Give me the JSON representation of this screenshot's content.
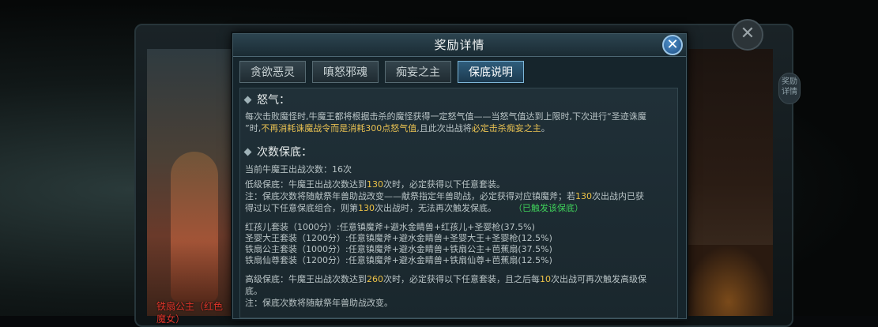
{
  "background": {
    "title": "",
    "left_name": "铁扇公主（红色\n魔女）",
    "side_tab": "奖励\n详情",
    "close_glyph": "✕"
  },
  "dialog": {
    "title": "奖励详情",
    "close_glyph": "✕",
    "tabs": [
      {
        "label": "贪欲恶灵",
        "active": false
      },
      {
        "label": "嗔怒邪魂",
        "active": false
      },
      {
        "label": "痴妄之主",
        "active": false
      },
      {
        "label": "保底说明",
        "active": true
      }
    ]
  },
  "rage": {
    "heading": "怒气：",
    "p1_a": "每次击败魔怪时,牛魔王都将根据击杀的魔怪获得一定怒气值——当怒气值达到上限时,下次进行“圣迹诛魔",
    "p1_b": "”时,",
    "p1_hl1": "不再消耗诛魔战令而是消耗300点怒气值",
    "p1_c": ",且此次出战将",
    "p1_hl2": "必定击杀痴妄之主",
    "p1_d": "。"
  },
  "pity": {
    "heading": "次数保底：",
    "current": "当前牛魔王出战次数：16次",
    "low_a": "低级保底：牛魔王出战次数达到",
    "low_num": "130",
    "low_b": "次时，必定获得以下任意套装。",
    "note1_a": "注：保底次数将随献祭年兽助战改变——献祭指定年兽助战，必定获得对应镇魔斧；若",
    "note1_num": "130",
    "note1_b": "次出战内已获",
    "note2_a": "得过以下任意保底组合，则第",
    "note2_num": "130",
    "note2_b": "次出战时，无法再次触发保底。",
    "triggered": "（已触发该保底）",
    "sets": [
      "红孩儿套装（1000分）:任意镇魔斧+避水金睛兽+红孩儿+圣婴枪(37.5%)",
      "圣婴大王套装（1200分）:任意镇魔斧+避水金睛兽+圣婴大王+圣婴枪(12.5%)",
      "铁扇公主套装（1000分）:任意镇魔斧+避水金睛兽+铁扇公主+芭蕉扇(37.5%)",
      "铁扇仙尊套装（1200分）:任意镇魔斧+避水金睛兽+铁扇仙尊+芭蕉扇(12.5%)"
    ],
    "high_a": "高级保底：牛魔王出战次数达到",
    "high_num": "260",
    "high_b": "次时，必定获得以下任意套装，且之后每",
    "high_num2": "10",
    "high_c": "次出战可再次触发高级保",
    "high_d": "底。",
    "note3": "注：保底次数将随献祭年兽助战改变。"
  },
  "colors": {
    "highlight": "#e8c152",
    "number": "#ecc247",
    "triggered": "#3fcf5a",
    "active_tab": "#2f5d7c"
  }
}
